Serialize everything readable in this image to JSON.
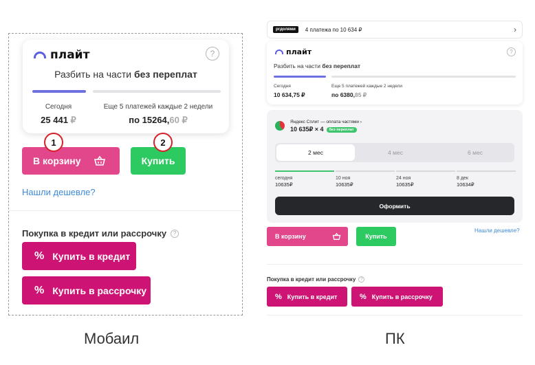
{
  "mobile": {
    "caption": "Мобаил",
    "card": {
      "brand": "плайт",
      "help": "?",
      "tagline_prefix": "Разбить на части",
      "tagline_bold": "без переплат",
      "today_label": "Сегодня",
      "today_amount": "25 441",
      "currency": "₽",
      "rest_label": "Еще 5 платежей каждые 2 недели",
      "rest_prefix": "по 15264,",
      "rest_frac": "60 ₽"
    },
    "badge_1": "1",
    "badge_2": "2",
    "cart_label": "В корзину",
    "buy_label": "Купить",
    "cheaper_link": "Нашли дешевле?",
    "credit_heading": "Покупка в кредит или рассрочку",
    "credit_button": "Купить в кредит",
    "installment_button": "Купить в рассрочку",
    "percent_icon": "%"
  },
  "pc": {
    "caption": "ПК",
    "top": {
      "logo": "рrдолями",
      "text": "4 платежа по 10 634 ₽",
      "chevron": "›"
    },
    "card": {
      "brand": "плайт",
      "help": "?",
      "tagline_prefix": "Разбить на части",
      "tagline_bold": "без переплат",
      "today_label": "Сегодня",
      "today_amount": "10 634,75 ₽",
      "rest_label": "Еще 5 платежей каждые 2 недели",
      "rest_prefix": "по 6380,",
      "rest_frac": "85 ₽"
    },
    "split": {
      "title": "Яндекс Сплит — оплата частями ›",
      "amount": "10 635₽ × 4",
      "no_overpay": "без переплат",
      "tabs": [
        "2 мес",
        "4 мес",
        "6 мес"
      ],
      "schedule": [
        {
          "date": "сегодня",
          "amount": "10635₽"
        },
        {
          "date": "10 ноя",
          "amount": "10635₽"
        },
        {
          "date": "24 ноя",
          "amount": "10635₽"
        },
        {
          "date": "8 дек",
          "amount": "10634₽"
        }
      ],
      "order_button": "Оформить"
    },
    "cart_label": "В корзину",
    "buy_label": "Купить",
    "cheaper_link": "Нашли дешевле?",
    "credit_heading": "Покупка в кредит или рассрочку",
    "credit_button": "Купить в кредит",
    "installment_button": "Купить в рассрочку",
    "percent_icon": "%"
  }
}
